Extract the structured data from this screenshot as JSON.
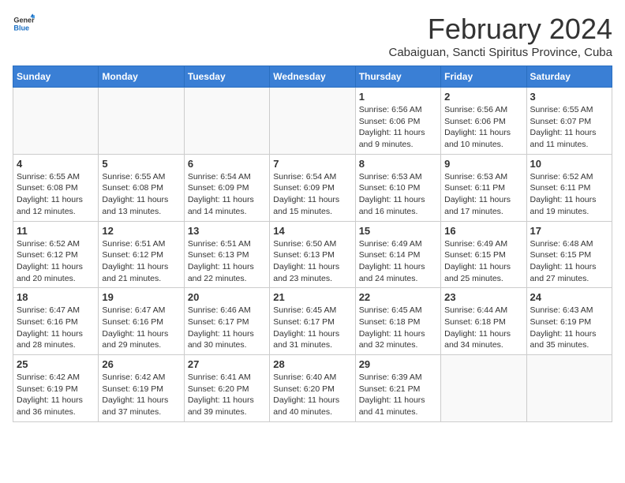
{
  "logo": {
    "general": "General",
    "blue": "Blue"
  },
  "header": {
    "month": "February 2024",
    "location": "Cabaiguan, Sancti Spiritus Province, Cuba"
  },
  "weekdays": [
    "Sunday",
    "Monday",
    "Tuesday",
    "Wednesday",
    "Thursday",
    "Friday",
    "Saturday"
  ],
  "weeks": [
    [
      {
        "day": "",
        "info": ""
      },
      {
        "day": "",
        "info": ""
      },
      {
        "day": "",
        "info": ""
      },
      {
        "day": "",
        "info": ""
      },
      {
        "day": "1",
        "info": "Sunrise: 6:56 AM\nSunset: 6:06 PM\nDaylight: 11 hours\nand 9 minutes."
      },
      {
        "day": "2",
        "info": "Sunrise: 6:56 AM\nSunset: 6:06 PM\nDaylight: 11 hours\nand 10 minutes."
      },
      {
        "day": "3",
        "info": "Sunrise: 6:55 AM\nSunset: 6:07 PM\nDaylight: 11 hours\nand 11 minutes."
      }
    ],
    [
      {
        "day": "4",
        "info": "Sunrise: 6:55 AM\nSunset: 6:08 PM\nDaylight: 11 hours\nand 12 minutes."
      },
      {
        "day": "5",
        "info": "Sunrise: 6:55 AM\nSunset: 6:08 PM\nDaylight: 11 hours\nand 13 minutes."
      },
      {
        "day": "6",
        "info": "Sunrise: 6:54 AM\nSunset: 6:09 PM\nDaylight: 11 hours\nand 14 minutes."
      },
      {
        "day": "7",
        "info": "Sunrise: 6:54 AM\nSunset: 6:09 PM\nDaylight: 11 hours\nand 15 minutes."
      },
      {
        "day": "8",
        "info": "Sunrise: 6:53 AM\nSunset: 6:10 PM\nDaylight: 11 hours\nand 16 minutes."
      },
      {
        "day": "9",
        "info": "Sunrise: 6:53 AM\nSunset: 6:11 PM\nDaylight: 11 hours\nand 17 minutes."
      },
      {
        "day": "10",
        "info": "Sunrise: 6:52 AM\nSunset: 6:11 PM\nDaylight: 11 hours\nand 19 minutes."
      }
    ],
    [
      {
        "day": "11",
        "info": "Sunrise: 6:52 AM\nSunset: 6:12 PM\nDaylight: 11 hours\nand 20 minutes."
      },
      {
        "day": "12",
        "info": "Sunrise: 6:51 AM\nSunset: 6:12 PM\nDaylight: 11 hours\nand 21 minutes."
      },
      {
        "day": "13",
        "info": "Sunrise: 6:51 AM\nSunset: 6:13 PM\nDaylight: 11 hours\nand 22 minutes."
      },
      {
        "day": "14",
        "info": "Sunrise: 6:50 AM\nSunset: 6:13 PM\nDaylight: 11 hours\nand 23 minutes."
      },
      {
        "day": "15",
        "info": "Sunrise: 6:49 AM\nSunset: 6:14 PM\nDaylight: 11 hours\nand 24 minutes."
      },
      {
        "day": "16",
        "info": "Sunrise: 6:49 AM\nSunset: 6:15 PM\nDaylight: 11 hours\nand 25 minutes."
      },
      {
        "day": "17",
        "info": "Sunrise: 6:48 AM\nSunset: 6:15 PM\nDaylight: 11 hours\nand 27 minutes."
      }
    ],
    [
      {
        "day": "18",
        "info": "Sunrise: 6:47 AM\nSunset: 6:16 PM\nDaylight: 11 hours\nand 28 minutes."
      },
      {
        "day": "19",
        "info": "Sunrise: 6:47 AM\nSunset: 6:16 PM\nDaylight: 11 hours\nand 29 minutes."
      },
      {
        "day": "20",
        "info": "Sunrise: 6:46 AM\nSunset: 6:17 PM\nDaylight: 11 hours\nand 30 minutes."
      },
      {
        "day": "21",
        "info": "Sunrise: 6:45 AM\nSunset: 6:17 PM\nDaylight: 11 hours\nand 31 minutes."
      },
      {
        "day": "22",
        "info": "Sunrise: 6:45 AM\nSunset: 6:18 PM\nDaylight: 11 hours\nand 32 minutes."
      },
      {
        "day": "23",
        "info": "Sunrise: 6:44 AM\nSunset: 6:18 PM\nDaylight: 11 hours\nand 34 minutes."
      },
      {
        "day": "24",
        "info": "Sunrise: 6:43 AM\nSunset: 6:19 PM\nDaylight: 11 hours\nand 35 minutes."
      }
    ],
    [
      {
        "day": "25",
        "info": "Sunrise: 6:42 AM\nSunset: 6:19 PM\nDaylight: 11 hours\nand 36 minutes."
      },
      {
        "day": "26",
        "info": "Sunrise: 6:42 AM\nSunset: 6:19 PM\nDaylight: 11 hours\nand 37 minutes."
      },
      {
        "day": "27",
        "info": "Sunrise: 6:41 AM\nSunset: 6:20 PM\nDaylight: 11 hours\nand 39 minutes."
      },
      {
        "day": "28",
        "info": "Sunrise: 6:40 AM\nSunset: 6:20 PM\nDaylight: 11 hours\nand 40 minutes."
      },
      {
        "day": "29",
        "info": "Sunrise: 6:39 AM\nSunset: 6:21 PM\nDaylight: 11 hours\nand 41 minutes."
      },
      {
        "day": "",
        "info": ""
      },
      {
        "day": "",
        "info": ""
      }
    ]
  ]
}
